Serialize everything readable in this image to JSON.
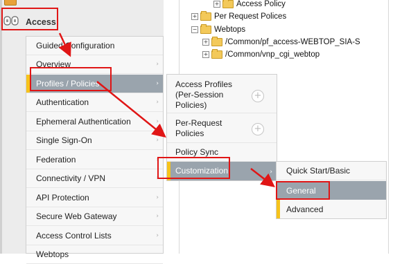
{
  "sidebar": {
    "access_label": "Access"
  },
  "tree": {
    "items": [
      {
        "label": "Access Policy",
        "expander": "+"
      },
      {
        "label": "Per Request Polices",
        "expander": "+"
      },
      {
        "label": "Webtops",
        "expander": "−"
      },
      {
        "label": "/Common/pf_access-WEBTOP_SIA-S",
        "expander": "+"
      },
      {
        "label": "/Common/vnp_cgi_webtop",
        "expander": "+"
      }
    ]
  },
  "menu_level1": {
    "items": [
      {
        "label": "Guided Configuration"
      },
      {
        "label": "Overview"
      },
      {
        "label": "Profiles / Policies"
      },
      {
        "label": "Authentication"
      },
      {
        "label": "Ephemeral Authentication"
      },
      {
        "label": "Single Sign-On"
      },
      {
        "label": "Federation"
      },
      {
        "label": "Connectivity / VPN"
      },
      {
        "label": "API Protection"
      },
      {
        "label": "Secure Web Gateway"
      },
      {
        "label": "Access Control Lists"
      },
      {
        "label": "Webtops"
      }
    ],
    "selected": "Profiles / Policies"
  },
  "menu_level2": {
    "items": [
      {
        "label": "Access Profiles (Per-Session Policies)",
        "add": "+"
      },
      {
        "label": "Per-Request Policies",
        "add": "+"
      },
      {
        "label": "Policy Sync"
      },
      {
        "label": "Customization"
      }
    ],
    "selected": "Customization"
  },
  "menu_level3": {
    "items": [
      {
        "label": "Quick Start/Basic"
      },
      {
        "label": "General"
      },
      {
        "label": "Advanced"
      }
    ],
    "selected": "General"
  },
  "chevron": "›",
  "colors": {
    "highlight_red": "#e01515",
    "selected_bg": "#9aa4ad",
    "selected_bar": "#f6c31b"
  }
}
